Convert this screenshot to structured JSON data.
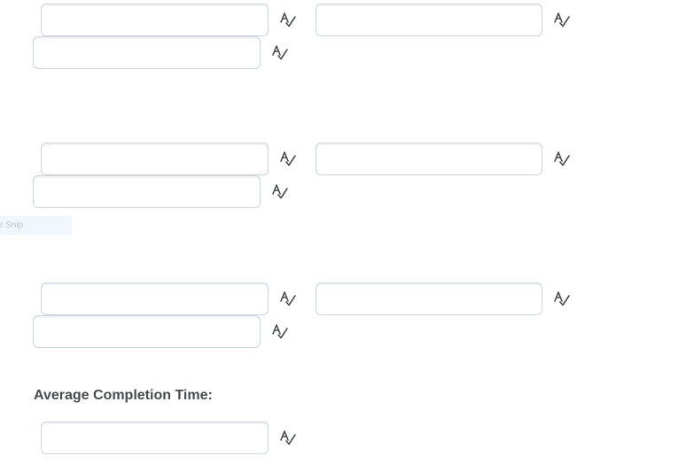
{
  "groups": [
    {
      "fields": [
        {
          "value": ""
        },
        {
          "value": ""
        },
        {
          "value": ""
        }
      ]
    },
    {
      "fields": [
        {
          "value": ""
        },
        {
          "value": ""
        },
        {
          "value": ""
        }
      ]
    },
    {
      "fields": [
        {
          "value": ""
        },
        {
          "value": ""
        },
        {
          "value": ""
        }
      ]
    }
  ],
  "overlay": {
    "snip_text": "r Snip"
  },
  "completion": {
    "label": "Average Completion Time:",
    "value": ""
  },
  "icons": {
    "spellcheck": "spellcheck-icon"
  },
  "colors": {
    "field_border": "#cdd5dc",
    "icon": "#494c4e",
    "label": "#494c4e",
    "overlay_bg": "#f1f8fd"
  }
}
